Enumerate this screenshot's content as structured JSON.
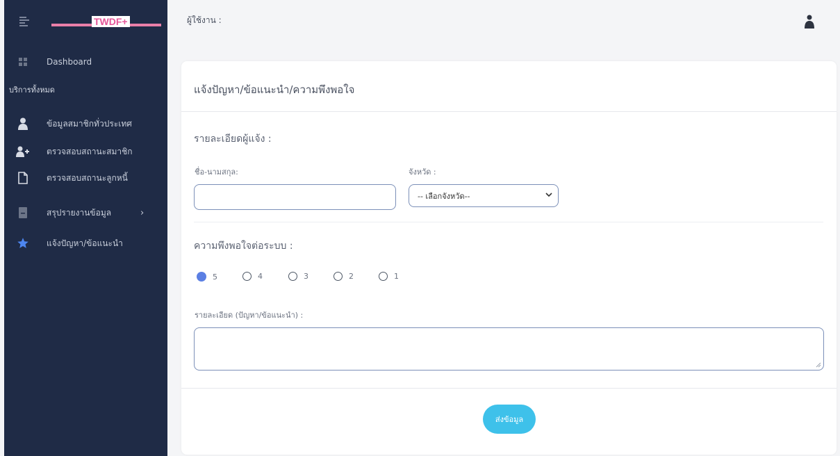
{
  "sidebar": {
    "logo_text": "TWDF+",
    "items": [
      {
        "label": "Dashboard"
      },
      {
        "label": "ข้อมูลสมาชิกทั่วประเทศ"
      },
      {
        "label": "ตรวจสอบสถานะสมาชิก"
      },
      {
        "label": "ตรวจสอบสถานะลูกหนี้"
      },
      {
        "label": "สรุปรายงานข้อมูล"
      },
      {
        "label": "แจ้งปัญหา/ข้อแนะนำ"
      }
    ],
    "section_label": "บริการทั้งหมด",
    "chevron": "›"
  },
  "topbar": {
    "user_label": "ผู้ใช้งาน :"
  },
  "form": {
    "title": "แจ้งปัญหา/ข้อแนะนำ/ความพึงพอใจ",
    "reporter_section": "รายละเอียดผู้แจ้ง :",
    "name_label": "ชื่อ-นามสกุล:",
    "name_value": "",
    "province_label": "จังหวัด :",
    "province_selected": "-- เลือกจังหวัด--",
    "satisfaction_section": "ความพึงพอใจต่อระบบ :",
    "ratings": [
      "5",
      "4",
      "3",
      "2",
      "1"
    ],
    "selected_rating": "5",
    "details_label": "รายละเอียด (ปัญหา/ข้อแนะนำ) :",
    "details_value": "",
    "submit_label": "ส่งข้อมูล"
  },
  "colors": {
    "sidebar_bg": "#1f2b46",
    "accent": "#3ec1ea",
    "radio_checked": "#5b7fe3",
    "logo_pink": "#e5579a"
  }
}
